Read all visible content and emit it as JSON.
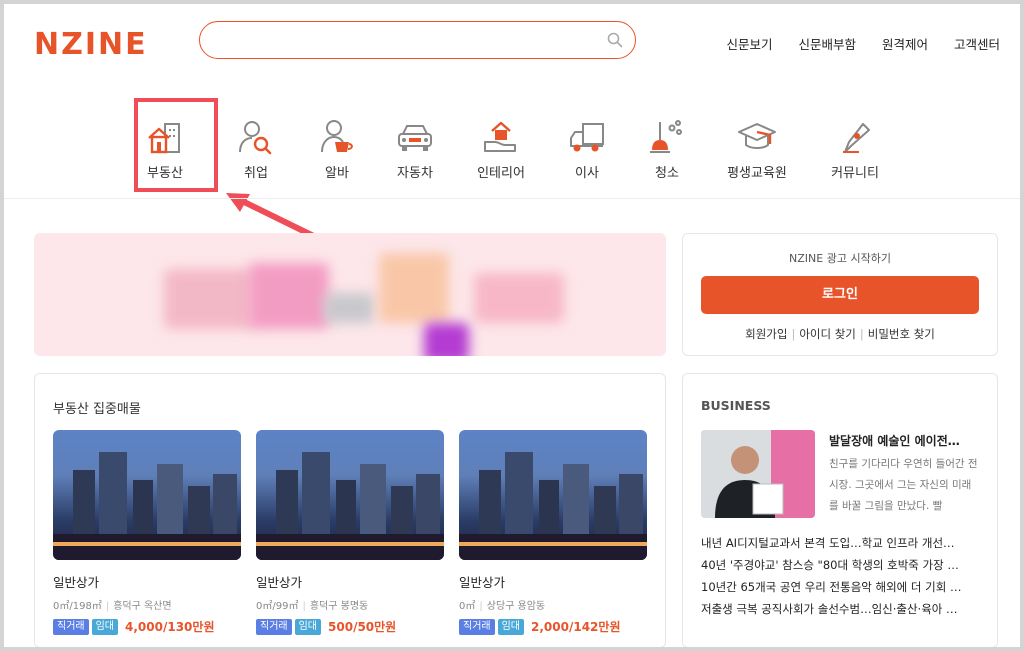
{
  "header": {
    "logo": "NZINE",
    "search": {
      "value": "",
      "placeholder": ""
    },
    "nav": [
      "신문보기",
      "신문배부함",
      "원격제어",
      "고객센터"
    ]
  },
  "categories": [
    {
      "label": "부동산",
      "icon": "real-estate-icon"
    },
    {
      "label": "취업",
      "icon": "job-search-icon"
    },
    {
      "label": "알바",
      "icon": "part-time-icon"
    },
    {
      "label": "자동차",
      "icon": "car-icon"
    },
    {
      "label": "인테리어",
      "icon": "interior-icon"
    },
    {
      "label": "이사",
      "icon": "moving-truck-icon"
    },
    {
      "label": "청소",
      "icon": "cleaning-icon"
    },
    {
      "label": "평생교육원",
      "icon": "education-icon"
    },
    {
      "label": "커뮤니티",
      "icon": "community-icon"
    }
  ],
  "login": {
    "ad_text": "NZINE 광고 시작하기",
    "button": "로그인",
    "links": [
      "회원가입",
      "아이디 찾기",
      "비밀번호 찾기"
    ]
  },
  "real_estate": {
    "title": "부동산 집중매물",
    "items": [
      {
        "name": "일반상가",
        "area": "0㎡/198㎡",
        "location": "흥덕구 옥산면",
        "tag1": "직거래",
        "tag2": "임대",
        "price": "4,000/130만원"
      },
      {
        "name": "일반상가",
        "area": "0㎡/99㎡",
        "location": "흥덕구 봉명동",
        "tag1": "직거래",
        "tag2": "임대",
        "price": "500/50만원"
      },
      {
        "name": "일반상가",
        "area": "0㎡",
        "location": "상당구 용암동",
        "tag1": "직거래",
        "tag2": "임대",
        "price": "2,000/142만원"
      }
    ]
  },
  "business": {
    "title": "BUSINESS",
    "featured": {
      "headline": "발달장애 예술인 에이전…",
      "body": "친구를 기다리다 우연히 들어간 전시장. 그곳에서 그는 자신의 미래를 바꿀 그림을 만났다. 빨"
    },
    "list": [
      "내년 AI디지털교과서 본격 도입…학교 인프라 개선…",
      "40년 '주경야교' 참스승 \"80대 학생의 호박죽 가장 …",
      "10년간 65개국 공연 우리 전통음악 해외에 더 기회 …",
      "저출생 극복 공직사회가 솔선수범…임신·출산·육아 …"
    ]
  },
  "colors": {
    "accent": "#e8542a",
    "highlight": "#ef4d57"
  }
}
